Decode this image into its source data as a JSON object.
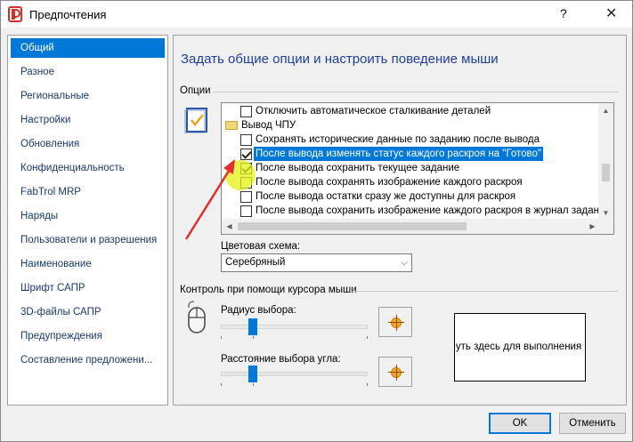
{
  "window": {
    "title": "Предпочтения",
    "help_glyph": "?",
    "close_glyph": "✕"
  },
  "sidebar": {
    "items": [
      {
        "label": "Общий",
        "selected": true
      },
      {
        "label": "Разное"
      },
      {
        "label": "Региональные"
      },
      {
        "label": "Настройки"
      },
      {
        "label": "Обновления"
      },
      {
        "label": "Конфиденциальность"
      },
      {
        "label": "FabTrol MRP"
      },
      {
        "label": "Наряды"
      },
      {
        "label": "Пользователи и разрешения"
      },
      {
        "label": "Наименование"
      },
      {
        "label": "Шрифт САПР"
      },
      {
        "label": "3D-файлы САПР"
      },
      {
        "label": "Предупреждения"
      },
      {
        "label": "Составление предложени..."
      }
    ]
  },
  "main": {
    "title": "Задать общие опции и настроить поведение мыши",
    "options_group_label": "Опции",
    "options": [
      {
        "label": "Отключить автоматическое сталкивание деталей",
        "checked": false
      },
      {
        "label": "Вывод ЧПУ",
        "folder": true
      },
      {
        "label": "Сохранять исторические данные по заданию после вывода",
        "checked": false
      },
      {
        "label": "После вывода изменять статус каждого раскроя на \"Готово\"",
        "checked": true,
        "selected": true
      },
      {
        "label": "После вывода сохранить текущее задание",
        "checked": true
      },
      {
        "label": "После вывода сохранять изображение каждого раскроя",
        "checked": false
      },
      {
        "label": "После вывода остатки сразу же доступны для раскроя",
        "checked": false
      },
      {
        "label": "После вывода сохранить изображение каждого раскроя в журнал заданий",
        "checked": false
      }
    ],
    "color_scheme_label": "Цветовая схема:",
    "color_scheme_value": "Серебряный",
    "mouse_group_label": "Контроль при помощи курсора мыши",
    "radius_label": "Радиус выбора:",
    "radius_level": 0.2,
    "angle_label": "Расстояние выбора угла:",
    "angle_level": 0.2,
    "click_area_text": "Щелкнуть здесь для выполнения проверки"
  },
  "buttons": {
    "ok": "OK",
    "cancel": "Отменить"
  },
  "colors": {
    "accent": "#0078d7",
    "title_blue": "#1e3f9a",
    "annotation_arrow": "#e03030",
    "highlight": "#e6f014"
  }
}
